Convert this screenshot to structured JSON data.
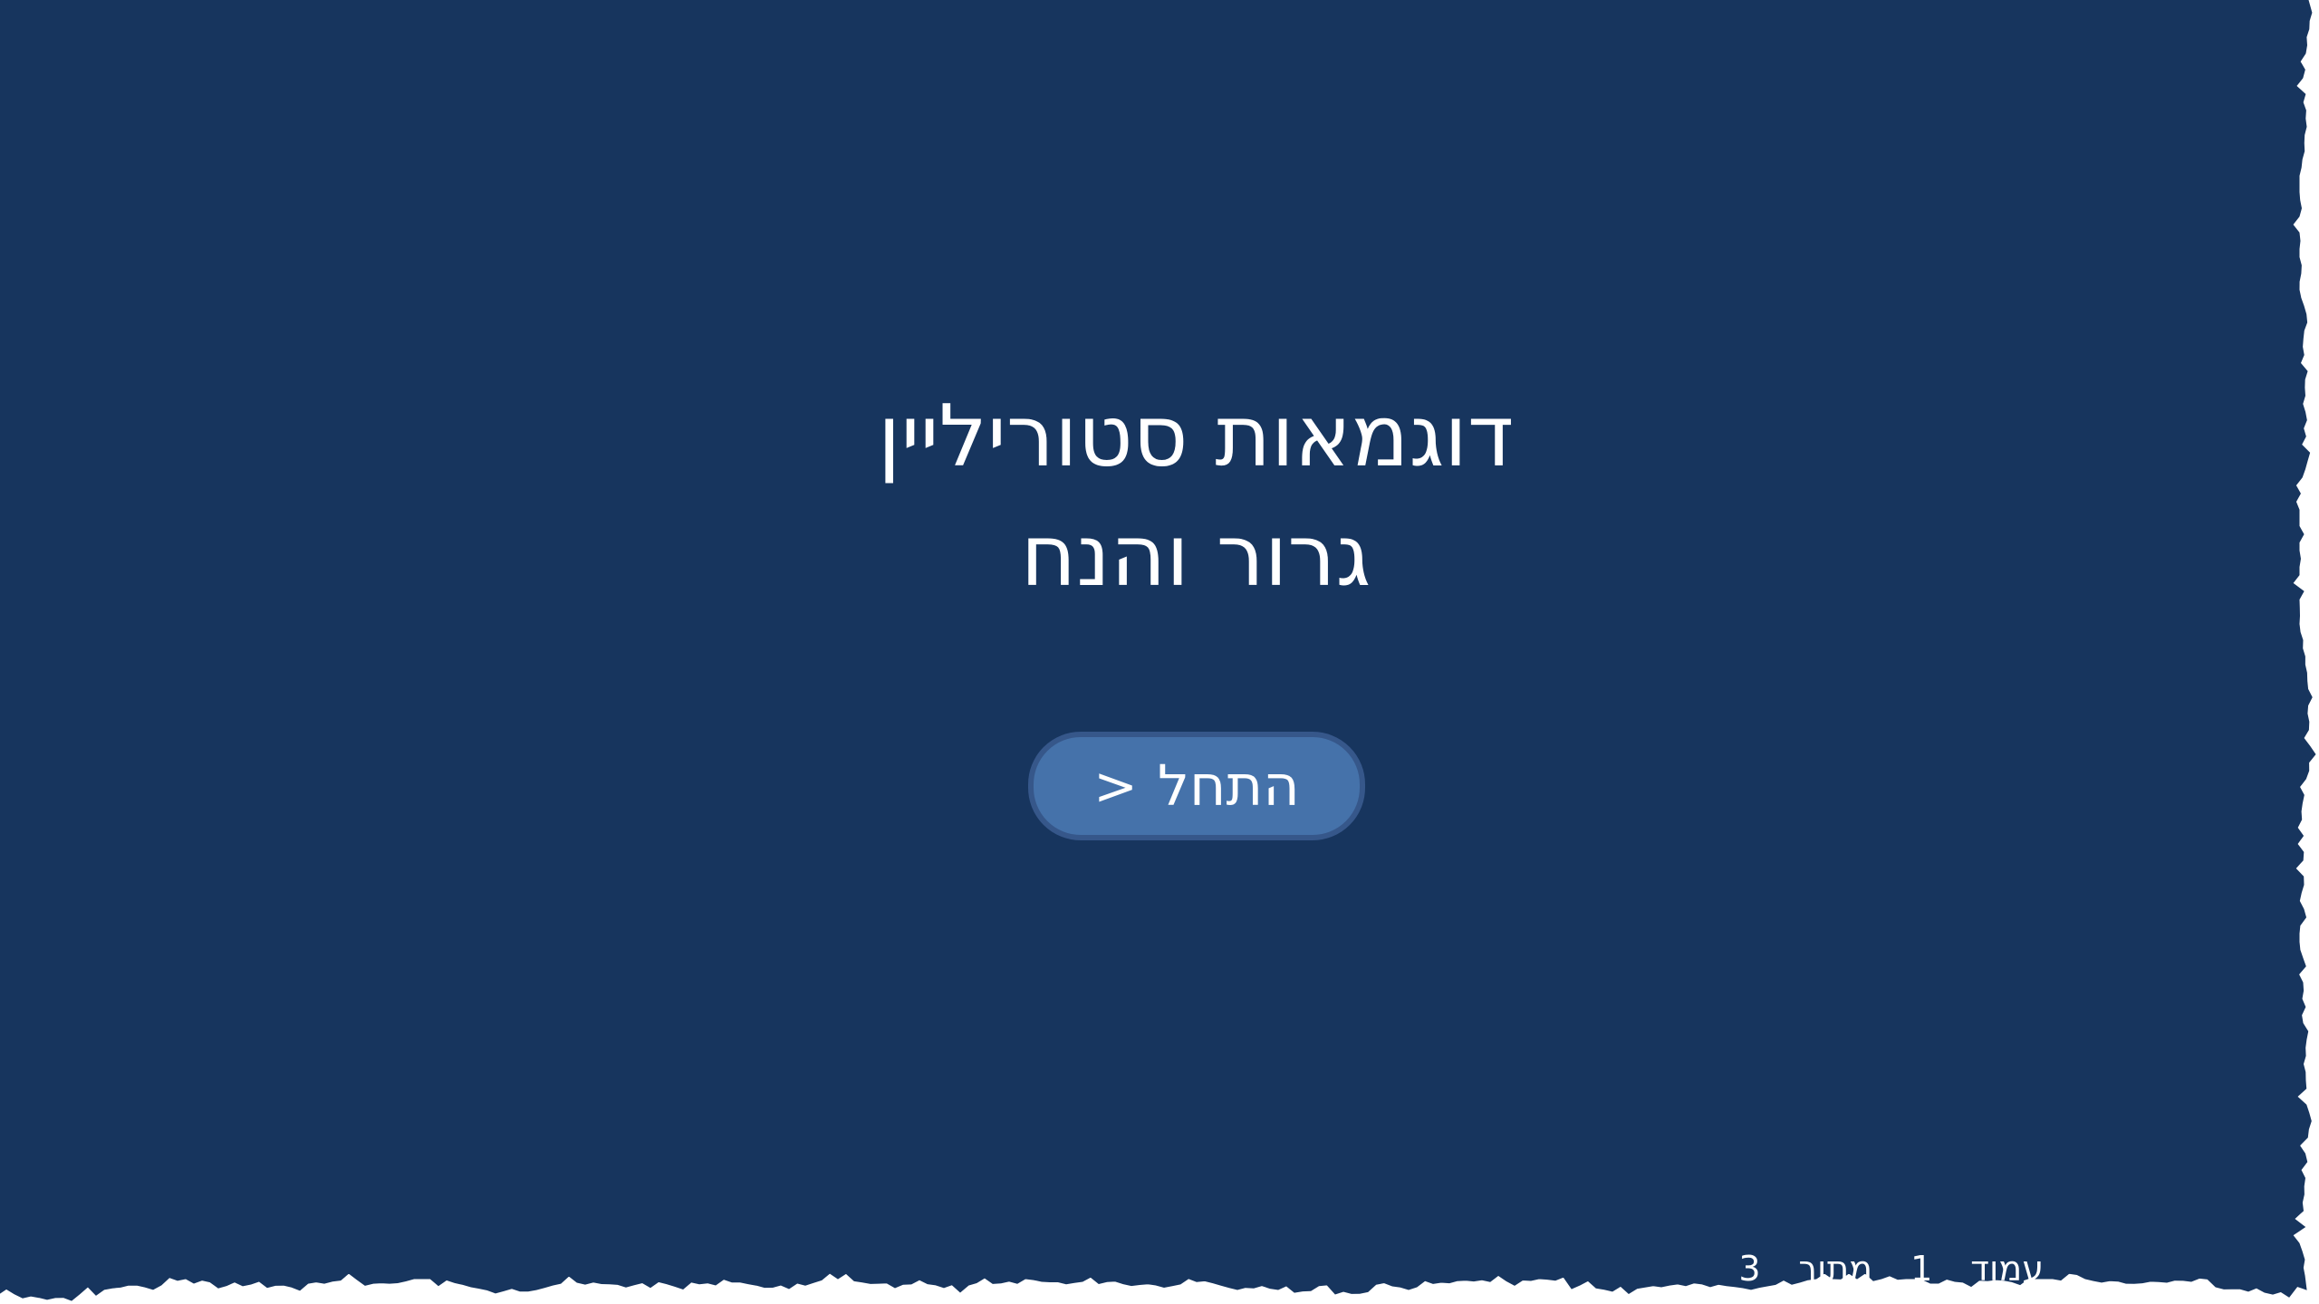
{
  "slide": {
    "background_color": "#17355e",
    "title_line_1": "דוגמאות סטוריליין",
    "title_line_2": "גרור והנח"
  },
  "start_button": {
    "label": "התחל",
    "arrow": "<",
    "fill_color": "#4572aa",
    "border_color": "#36578a"
  },
  "page_indicator": {
    "word_page": "עמוד",
    "current": "1",
    "word_of": "מתוך",
    "total": "3"
  }
}
